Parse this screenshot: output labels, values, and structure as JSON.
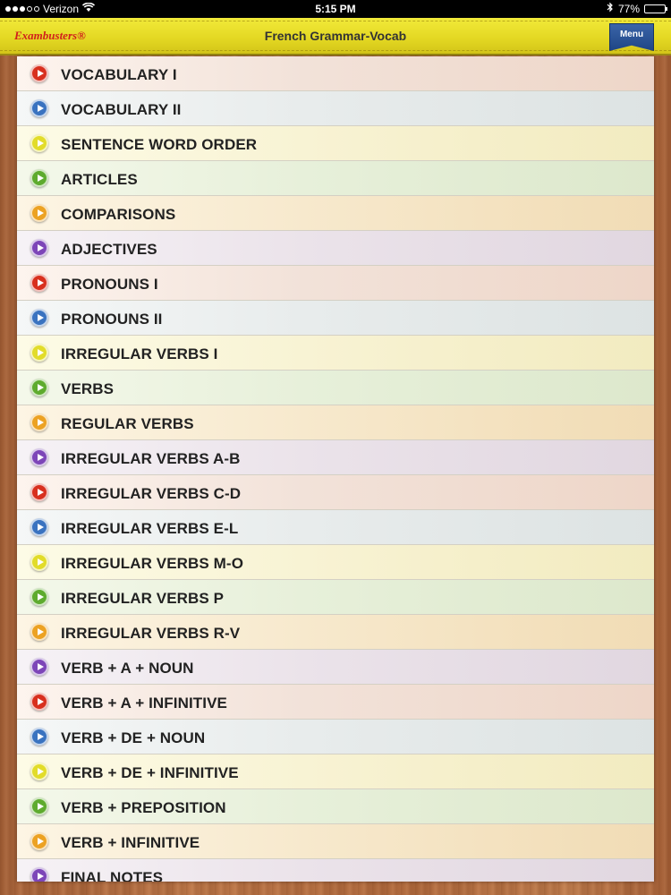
{
  "status_bar": {
    "carrier": "Verizon",
    "time": "5:15 PM",
    "battery": "77%",
    "battery_level": 0.77
  },
  "header": {
    "logo": "Exambusters®",
    "title": "French Grammar-Vocab",
    "menu_label": "Menu",
    "color": "#e6da26"
  },
  "list": {
    "items": [
      {
        "label": "VOCABULARY I",
        "color": "red"
      },
      {
        "label": "VOCABULARY II",
        "color": "blue"
      },
      {
        "label": "SENTENCE WORD ORDER",
        "color": "yellow"
      },
      {
        "label": "ARTICLES",
        "color": "green"
      },
      {
        "label": "COMPARISONS",
        "color": "orange"
      },
      {
        "label": "ADJECTIVES",
        "color": "purple"
      },
      {
        "label": "PRONOUNS I",
        "color": "red"
      },
      {
        "label": "PRONOUNS II",
        "color": "blue"
      },
      {
        "label": "IRREGULAR VERBS I",
        "color": "yellow"
      },
      {
        "label": "VERBS",
        "color": "green"
      },
      {
        "label": "REGULAR VERBS",
        "color": "orange"
      },
      {
        "label": "IRREGULAR VERBS A-B",
        "color": "purple"
      },
      {
        "label": "IRREGULAR VERBS C-D",
        "color": "red"
      },
      {
        "label": "IRREGULAR VERBS E-L",
        "color": "blue"
      },
      {
        "label": "IRREGULAR VERBS M-O",
        "color": "yellow"
      },
      {
        "label": "IRREGULAR VERBS P",
        "color": "green"
      },
      {
        "label": "IRREGULAR VERBS R-V",
        "color": "orange"
      },
      {
        "label": "VERB + A + NOUN",
        "color": "purple"
      },
      {
        "label": "VERB + A + INFINITIVE",
        "color": "red"
      },
      {
        "label": "VERB + DE + NOUN",
        "color": "blue"
      },
      {
        "label": "VERB + DE + INFINITIVE",
        "color": "yellow"
      },
      {
        "label": "VERB + PREPOSITION",
        "color": "green"
      },
      {
        "label": "VERB + INFINITIVE",
        "color": "orange"
      },
      {
        "label": "FINAL NOTES",
        "color": "purple"
      }
    ]
  },
  "icon_colors": {
    "red": "#d8301e",
    "blue": "#3a73c0",
    "yellow": "#e2dc2a",
    "green": "#5eab2e",
    "orange": "#eca223",
    "purple": "#7d46b8"
  },
  "icons": {
    "row": "play-icon",
    "wifi": "wifi-icon",
    "bluetooth": "bluetooth-icon",
    "battery": "battery-icon"
  }
}
